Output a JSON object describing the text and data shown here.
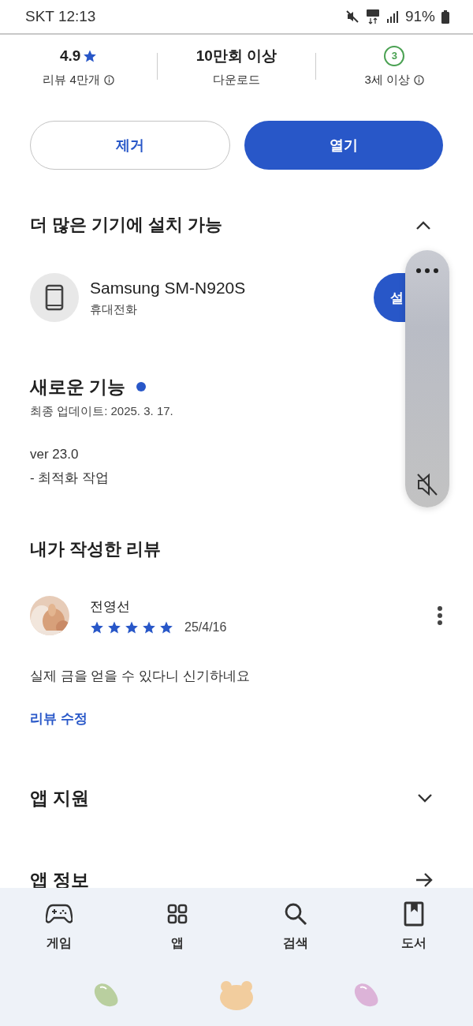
{
  "status_bar": {
    "carrier_time": "SKT 12:13",
    "battery": "91%"
  },
  "stats": [
    {
      "kind": "rating",
      "value": "4.9",
      "label": "리뷰 4만개",
      "info": true
    },
    {
      "kind": "plain",
      "value": "10만회 이상",
      "label": "다운로드",
      "info": false
    },
    {
      "kind": "age",
      "value": "3",
      "label": "3세 이상",
      "info": true
    }
  ],
  "buttons": [
    {
      "label": "제거",
      "kind": "outline"
    },
    {
      "label": "열기",
      "kind": "filled"
    }
  ],
  "devices_section": {
    "title": "더 많은 기기에 설치 가능",
    "expanded": true,
    "device": {
      "name": "Samsung SM-N920S",
      "type": "휴대전화",
      "button": "설"
    }
  },
  "whats_new": {
    "title": "새로운 기능",
    "new_dot": true,
    "updated": "최종 업데이트: 2025. 3. 17.",
    "notes": [
      "ver 23.0",
      "- 최적화 작업"
    ]
  },
  "my_review": {
    "title": "내가 작성한 리뷰",
    "author": "전영선",
    "stars": 5,
    "date": "25/4/16",
    "text": "실제 금을 얻을 수 있다니 신기하네요",
    "edit_link": "리뷰 수정"
  },
  "sections": [
    {
      "title": "앱 지원",
      "kind": "expand",
      "expanded": false
    },
    {
      "title": "앱 정보",
      "kind": "arrow"
    }
  ],
  "bottom_nav": [
    {
      "label": "게임",
      "kind": "games"
    },
    {
      "label": "앱",
      "kind": "apps"
    },
    {
      "label": "검색",
      "kind": "search"
    },
    {
      "label": "도서",
      "kind": "books"
    }
  ],
  "volume_panel": {
    "muted": true
  }
}
